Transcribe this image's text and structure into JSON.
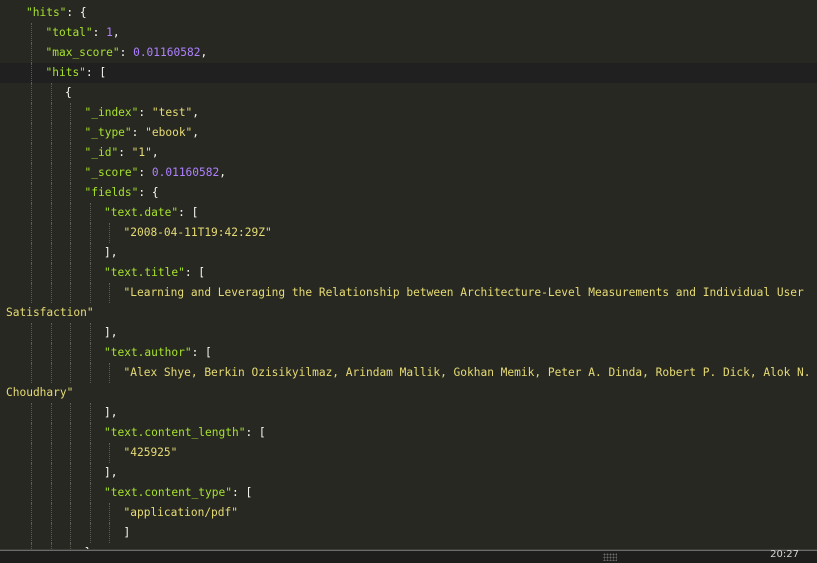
{
  "editor": {
    "lines": [
      {
        "indent": 1,
        "tokens": [
          {
            "t": "\"hits\"",
            "c": "kn"
          },
          {
            "t": ": {",
            "c": "p"
          }
        ]
      },
      {
        "indent": 2,
        "tokens": [
          {
            "t": "\"total\"",
            "c": "kn"
          },
          {
            "t": ": ",
            "c": "p"
          },
          {
            "t": "1",
            "c": "n"
          },
          {
            "t": ",",
            "c": "p"
          }
        ]
      },
      {
        "indent": 2,
        "tokens": [
          {
            "t": "\"max_score\"",
            "c": "kn"
          },
          {
            "t": ": ",
            "c": "p"
          },
          {
            "t": "0.01160582",
            "c": "n"
          },
          {
            "t": ",",
            "c": "p"
          }
        ]
      },
      {
        "indent": 2,
        "highlight": true,
        "tokens": [
          {
            "t": "\"hits\"",
            "c": "kn"
          },
          {
            "t": ": [",
            "c": "p"
          }
        ]
      },
      {
        "indent": 3,
        "tokens": [
          {
            "t": "{",
            "c": "p"
          }
        ]
      },
      {
        "indent": 4,
        "tokens": [
          {
            "t": "\"_index\"",
            "c": "kn"
          },
          {
            "t": ": ",
            "c": "p"
          },
          {
            "t": "\"test\"",
            "c": "s"
          },
          {
            "t": ",",
            "c": "p"
          }
        ]
      },
      {
        "indent": 4,
        "tokens": [
          {
            "t": "\"_type\"",
            "c": "kn"
          },
          {
            "t": ": ",
            "c": "p"
          },
          {
            "t": "\"ebook\"",
            "c": "s"
          },
          {
            "t": ",",
            "c": "p"
          }
        ]
      },
      {
        "indent": 4,
        "tokens": [
          {
            "t": "\"_id\"",
            "c": "kn"
          },
          {
            "t": ": ",
            "c": "p"
          },
          {
            "t": "\"1\"",
            "c": "s"
          },
          {
            "t": ",",
            "c": "p"
          }
        ]
      },
      {
        "indent": 4,
        "tokens": [
          {
            "t": "\"_score\"",
            "c": "kn"
          },
          {
            "t": ": ",
            "c": "p"
          },
          {
            "t": "0.01160582",
            "c": "n"
          },
          {
            "t": ",",
            "c": "p"
          }
        ]
      },
      {
        "indent": 4,
        "tokens": [
          {
            "t": "\"fields\"",
            "c": "kn"
          },
          {
            "t": ": {",
            "c": "p"
          }
        ]
      },
      {
        "indent": 5,
        "tokens": [
          {
            "t": "\"text.date\"",
            "c": "kn"
          },
          {
            "t": ": [",
            "c": "p"
          }
        ]
      },
      {
        "indent": 6,
        "tokens": [
          {
            "t": "\"2008-04-11T19:42:29Z\"",
            "c": "s"
          }
        ]
      },
      {
        "indent": 5,
        "tokens": [
          {
            "t": "],",
            "c": "p"
          }
        ]
      },
      {
        "indent": 5,
        "tokens": [
          {
            "t": "\"text.title\"",
            "c": "kn"
          },
          {
            "t": ": [",
            "c": "p"
          }
        ]
      },
      {
        "indent": 6,
        "tokens": [
          {
            "t": "\"Learning and Leveraging the Relationship between Architecture-Level Measurements and Individual User",
            "c": "s"
          }
        ]
      },
      {
        "indent": 0,
        "wrap": true,
        "tokens": [
          {
            "t": "Satisfaction\"",
            "c": "s"
          }
        ]
      },
      {
        "indent": 5,
        "tokens": [
          {
            "t": "],",
            "c": "p"
          }
        ]
      },
      {
        "indent": 5,
        "tokens": [
          {
            "t": "\"text.author\"",
            "c": "kn"
          },
          {
            "t": ": [",
            "c": "p"
          }
        ]
      },
      {
        "indent": 6,
        "tokens": [
          {
            "t": "\"Alex Shye, Berkin Ozisikyilmaz, Arindam Mallik, Gokhan Memik, Peter A. Dinda, Robert P. Dick, Alok N.",
            "c": "s"
          }
        ]
      },
      {
        "indent": 0,
        "wrap": true,
        "tokens": [
          {
            "t": "Choudhary\"",
            "c": "s"
          }
        ]
      },
      {
        "indent": 5,
        "tokens": [
          {
            "t": "],",
            "c": "p"
          }
        ]
      },
      {
        "indent": 5,
        "tokens": [
          {
            "t": "\"text.content_length\"",
            "c": "kn"
          },
          {
            "t": ": [",
            "c": "p"
          }
        ]
      },
      {
        "indent": 6,
        "tokens": [
          {
            "t": "\"425925\"",
            "c": "s"
          }
        ]
      },
      {
        "indent": 5,
        "tokens": [
          {
            "t": "],",
            "c": "p"
          }
        ]
      },
      {
        "indent": 5,
        "tokens": [
          {
            "t": "\"text.content_type\"",
            "c": "kn"
          },
          {
            "t": ": [",
            "c": "p"
          }
        ]
      },
      {
        "indent": 6,
        "tokens": [
          {
            "t": "\"application/pdf\"",
            "c": "s"
          }
        ]
      },
      {
        "indent": 6,
        "tokens": [
          {
            "t": "]",
            "c": "p"
          }
        ]
      },
      {
        "indent": 4,
        "tokens": [
          {
            "t": "}",
            "c": "p"
          }
        ]
      }
    ]
  },
  "statusbar": {
    "time": "20:27"
  },
  "colors": {
    "background": "#272822",
    "key": "#a6e22e",
    "string": "#e6db74",
    "number": "#ae81ff",
    "punctuation": "#f8f8f2"
  }
}
